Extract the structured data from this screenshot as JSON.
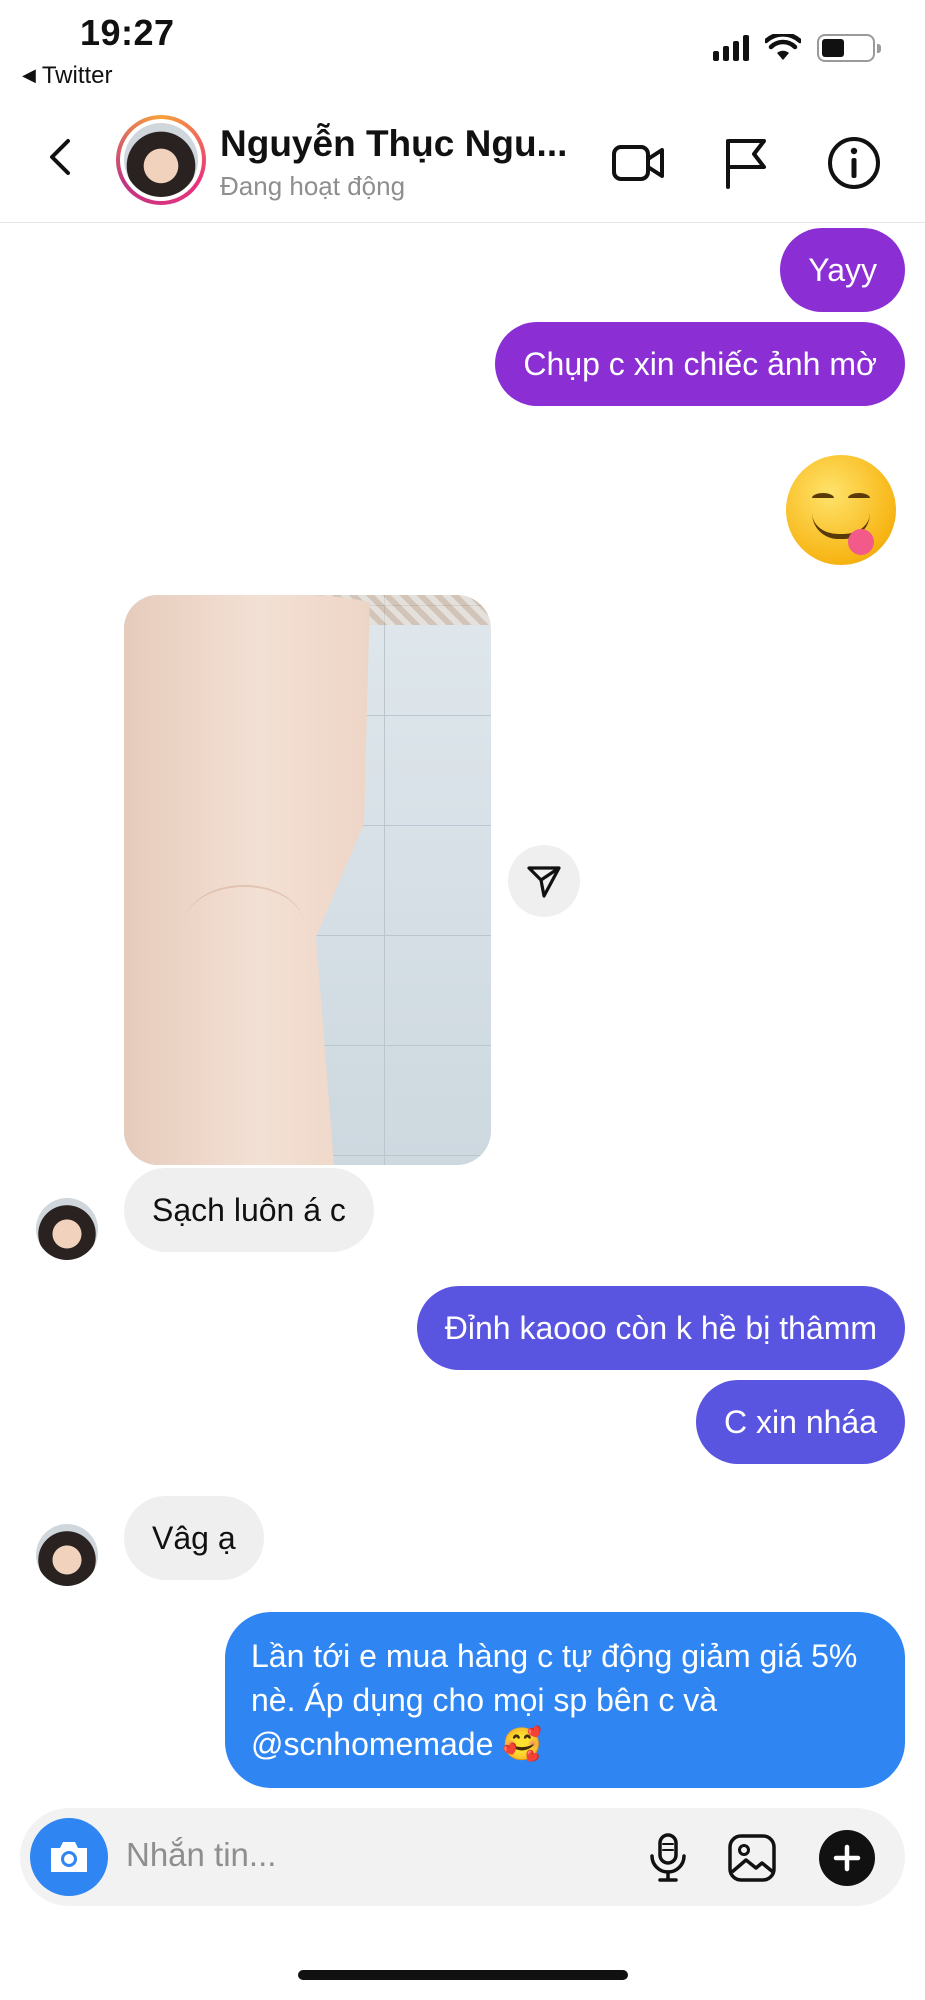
{
  "status_bar": {
    "time": "19:27",
    "back_app": "Twitter"
  },
  "header": {
    "contact_name": "Nguyễn Thục Ngu...",
    "contact_status": "Đang hoạt động"
  },
  "messages": {
    "m1": "Yayy",
    "m2": "Chụp c xin chiếc ảnh mờ",
    "m3": "Sạch luôn á c",
    "m4": "Đỉnh kaooo còn k hề bị thâmm",
    "m5": "C xin nháa",
    "m6": "Vâg ạ",
    "m7": "Lần tới e mua hàng c tự động giảm giá 5% nè. Áp dụng cho mọi sp bên c và @scnhomemade 🥰"
  },
  "composer": {
    "placeholder": "Nhắn tin..."
  },
  "colors": {
    "outgoing_purple": "#8b2fd4",
    "outgoing_violet": "#5a55e0",
    "outgoing_blue": "#2f86f2",
    "incoming_gray": "#efefef",
    "camera_button": "#2f86f2"
  },
  "icons": {
    "header": [
      "back-chevron-icon",
      "video-call-icon",
      "flag-icon",
      "info-icon"
    ],
    "composer": [
      "camera-icon",
      "microphone-icon",
      "gallery-icon",
      "plus-icon"
    ],
    "message": [
      "share-icon"
    ]
  }
}
